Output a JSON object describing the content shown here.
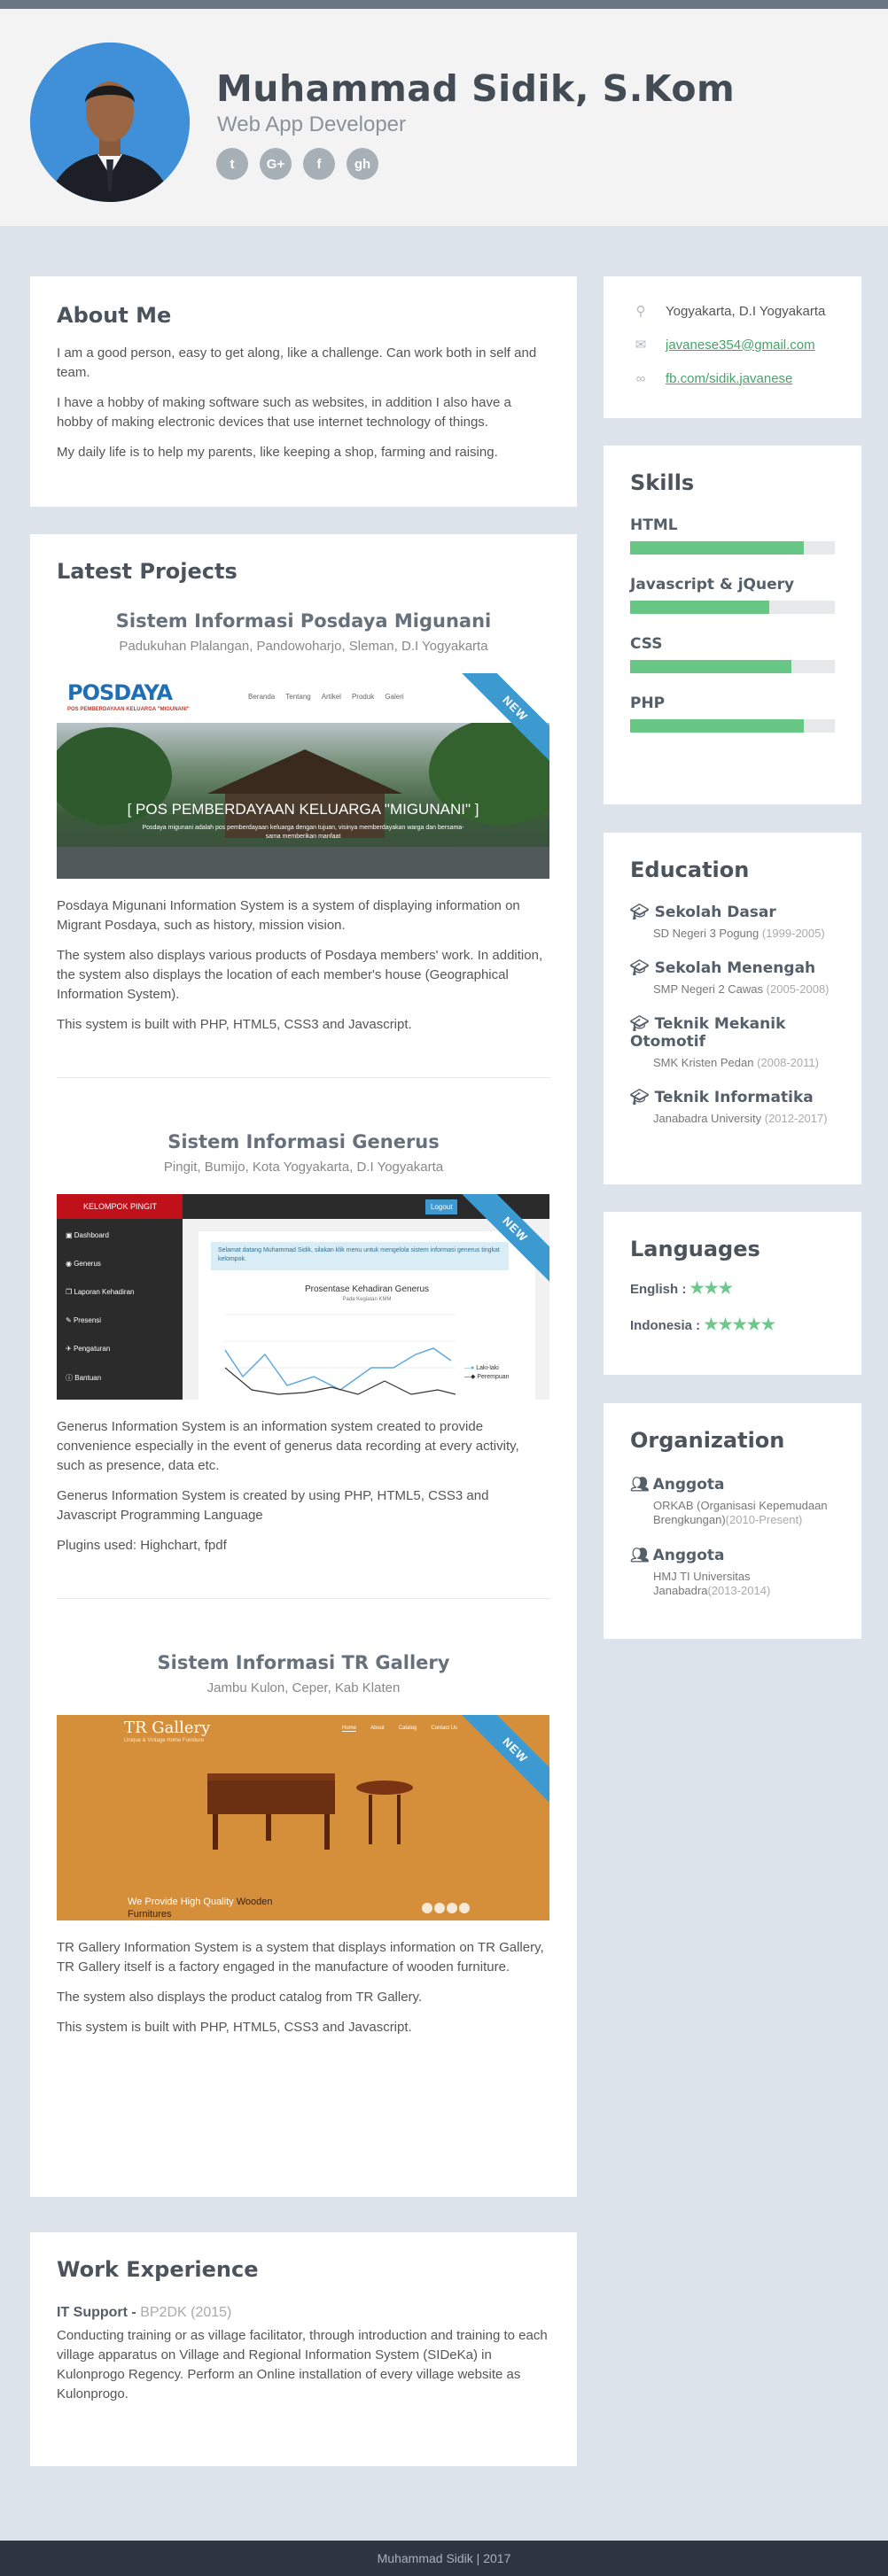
{
  "header": {
    "name": "Muhammad Sidik, S.Kom",
    "role": "Web App Developer",
    "socials": [
      {
        "icon": "twitter-icon",
        "glyph": "t"
      },
      {
        "icon": "google-plus-icon",
        "glyph": "G+"
      },
      {
        "icon": "facebook-icon",
        "glyph": "f"
      },
      {
        "icon": "github-icon",
        "glyph": "gh"
      }
    ]
  },
  "about": {
    "title": "About Me",
    "paragraphs": [
      "I am a good person, easy to get along, like a challenge. Can work both in self and team.",
      "I have a hobby of making software such as websites, in addition I also have a hobby of making electronic devices that use internet technology of things.",
      "My daily life is to help my parents, like keeping a shop, farming and raising."
    ]
  },
  "projects": {
    "title": "Latest Projects",
    "ribbon": "NEW",
    "items": [
      {
        "title": "Sistem Informasi Posdaya Migunani",
        "location": "Padukuhan Plalangan, Pandowoharjo, Sleman, D.I Yogyakarta",
        "shot": {
          "logo": "POSDAYA",
          "logo_sub": "POS PEMBERDAYAAN KELUARGA \"MIGUNANI\"",
          "nav": [
            "Beranda",
            "Tentang",
            "Artikel",
            "Produk",
            "Galeri"
          ],
          "banner": "[ POS PEMBERDAYAAN KELUARGA \"MIGUNANI\" ]",
          "caption": "Posdaya migunani adalah pos pemberdayaan keluarga dengan tujuan, visinya memberdayakan warga dan bersama-sama memberikan manfaat"
        },
        "paragraphs": [
          "Posdaya Migunani Information System is a system of displaying information on Migrant Posdaya, such as history, mission vision.",
          "The system also displays various products of Posdaya members' work. In addition, the system also displays the location of each member's house (Geographical Information System).",
          "This system is built with PHP, HTML5, CSS3 and Javascript."
        ]
      },
      {
        "title": "Sistem Informasi Generus",
        "location": "Pingit, Bumijo, Kota Yogyakarta, D.I Yogyakarta",
        "shot": {
          "brand": "KELOMPOK PINGIT",
          "logout": "Logout",
          "menu": [
            "Dashboard",
            "Generus",
            "Laporan Kehadiran",
            "Presensi",
            "Pengaturan",
            "Bantuan"
          ],
          "alert": "Selamat datang Muhammad Sidik, silakan klik menu untuk mengelola sistem informasi generus tingkat kelompok.",
          "chart_title": "Prosentase Kehadiran Generus",
          "chart_sub": "Pada Kegiatan KMM",
          "legend": [
            "Laki-laki",
            "Perempuan"
          ]
        },
        "paragraphs": [
          "Generus Information System is an information system created to provide convenience especially in the event of generus data recording at every activity, such as presence, data etc.",
          "Generus Information System is created by using PHP, HTML5, CSS3 and Javascript Programming Language",
          "Plugins used: Highchart, fpdf"
        ]
      },
      {
        "title": "Sistem Informasi TR Gallery",
        "location": "Jambu Kulon, Ceper, Kab Klaten",
        "shot": {
          "brand": "TR Gallery",
          "tagline": "Unique & Vintage Home Furniture",
          "nav": [
            "Home",
            "About",
            "Catalog",
            "Contact Us"
          ],
          "slogan_a": "We Provide High Quality ",
          "slogan_b": "Wooden",
          "slogan_c": "Furnitures"
        },
        "paragraphs": [
          "TR Gallery Information System is a system that displays information on TR Gallery, TR Gallery itself is a factory engaged in the manufacture of wooden furniture.",
          "The system also displays the product catalog from TR Gallery.",
          "This system is built with PHP, HTML5, CSS3 and Javascript."
        ]
      }
    ]
  },
  "work": {
    "title": "Work Experience",
    "role": "IT Support - ",
    "company": "BP2DK (2015)",
    "description": "Conducting training or as village facilitator, through introduction and training to each village apparatus on Village and Regional Information System (SIDeKa) in Kulonprogo Regency. Perform an Online installation of every village website as Kulonprogo."
  },
  "contact": {
    "location": "Yogyakarta, D.I Yogyakarta",
    "email": "javanese354@gmail.com",
    "facebook": "fb.com/sidik.javanese"
  },
  "skills": {
    "title": "Skills",
    "items": [
      {
        "name": "HTML",
        "level": 0.85
      },
      {
        "name": "Javascript & jQuery",
        "level": 0.68
      },
      {
        "name": "CSS",
        "level": 0.79
      },
      {
        "name": "PHP",
        "level": 0.85
      }
    ]
  },
  "education": {
    "title": "Education",
    "items": [
      {
        "level": "Sekolah Dasar",
        "school": "SD Negeri 3 Pogung",
        "years": "(1999-2005)"
      },
      {
        "level": "Sekolah Menengah",
        "school": "SMP Negeri 2 Cawas",
        "years": "(2005-2008)"
      },
      {
        "level": "Teknik Mekanik Otomotif",
        "school": "SMK Kristen Pedan",
        "years": "(2008-2011)"
      },
      {
        "level": "Teknik Informatika",
        "school": "Janabadra University",
        "years": "(2012-2017)"
      }
    ]
  },
  "languages": {
    "title": "Languages",
    "items": [
      {
        "name": "English",
        "stars": 3
      },
      {
        "name": "Indonesia",
        "stars": 5
      }
    ]
  },
  "organization": {
    "title": "Organization",
    "items": [
      {
        "role": "Anggota",
        "org": "ORKAB (Organisasi Kepemudaan Brengkungan)",
        "years": "(2010-Present)"
      },
      {
        "role": "Anggota",
        "org": "HMJ TI Universitas Janabadra",
        "years": "(2013-2014)"
      }
    ]
  },
  "footer": {
    "text": "Muhammad Sidik | 2017"
  },
  "colors": {
    "accent_green": "#69c786",
    "ribbon_blue": "#3d9ad1",
    "footer_bg": "#303641"
  }
}
